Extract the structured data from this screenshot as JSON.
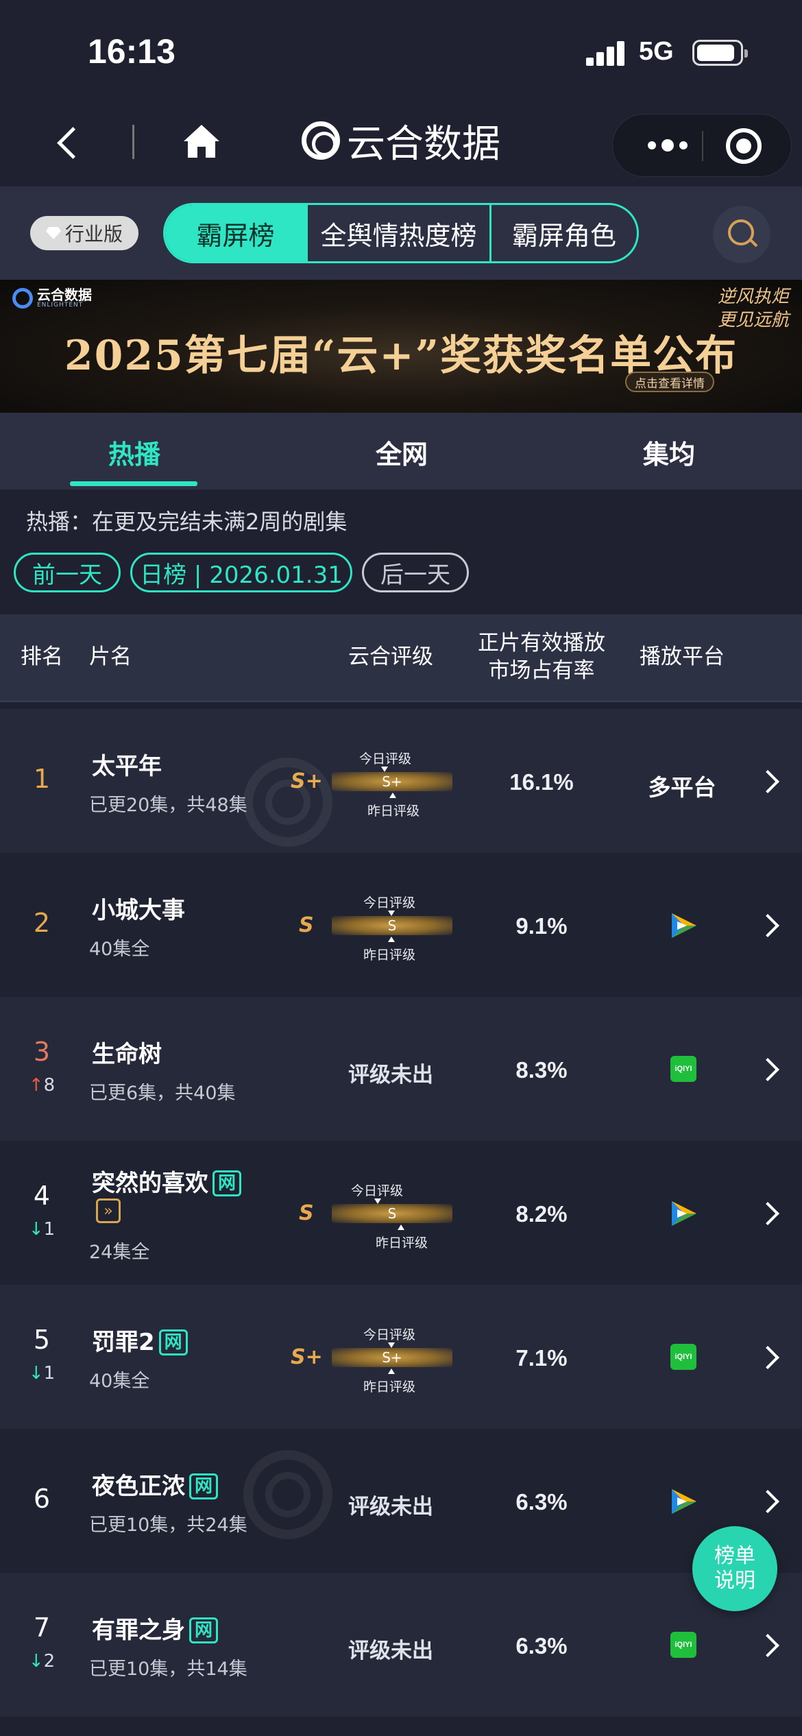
{
  "status_bar": {
    "time": "16:13",
    "network": "5G"
  },
  "nav": {
    "app_title": "云合数据"
  },
  "type_bar": {
    "badge": "行业版",
    "segments": [
      "霸屏榜",
      "全舆情热度榜",
      "霸屏角色"
    ],
    "active_segment": "霸屏榜"
  },
  "banner": {
    "logo_text": "云合数据",
    "logo_sub": "ENLIGHTENT",
    "title": "2025第七届“云+”奖获奖名单公布",
    "slogan_line1": "逆风执炬",
    "slogan_line2": "更见远航",
    "cta": "点击查看详情"
  },
  "list_tabs": {
    "items": [
      "热播",
      "全网",
      "集均"
    ],
    "active": "热播"
  },
  "description": "热播：在更及完结未满2周的剧集",
  "date_nav": {
    "prev": "前一天",
    "current": "日榜 | 2026.01.31",
    "next": "后一天"
  },
  "table_header": {
    "rank": "排名",
    "name": "片名",
    "grade": "云合评级",
    "share_line1": "正片有效播放",
    "share_line2": "市场占有率",
    "platform": "播放平台"
  },
  "grade_labels": {
    "today": "今日评级",
    "yesterday": "昨日评级"
  },
  "rows": [
    {
      "rank": "1",
      "title": "太平年",
      "net_badge": "",
      "subtitle": "已更20集，共48集",
      "grade": "S+",
      "grade_bar": "S+",
      "share": "16.1%",
      "platform": "多平台",
      "platform_icon": "",
      "trend": "",
      "trend_dir": ""
    },
    {
      "rank": "2",
      "title": "小城大事",
      "net_badge": "",
      "subtitle": "40集全",
      "grade": "S",
      "grade_bar": "S",
      "share": "9.1%",
      "platform": "",
      "platform_icon": "tencent-video-icon",
      "trend": "",
      "trend_dir": ""
    },
    {
      "rank": "3",
      "title": "生命树",
      "net_badge": "",
      "subtitle": "已更6集，共40集",
      "grade": "评级未出",
      "grade_bar": "",
      "share": "8.3%",
      "platform": "",
      "platform_icon": "iqiyi-icon",
      "trend": "8",
      "trend_dir": "up"
    },
    {
      "rank": "4",
      "title": "突然的喜欢",
      "net_badge": "网",
      "subtitle": "24集全",
      "grade": "S",
      "grade_bar": "S",
      "share": "8.2%",
      "platform": "",
      "platform_icon": "tencent-video-icon",
      "trend": "1",
      "trend_dir": "down"
    },
    {
      "rank": "5",
      "title": "罚罪2",
      "net_badge": "网",
      "subtitle": "40集全",
      "grade": "S+",
      "grade_bar": "S+",
      "share": "7.1%",
      "platform": "",
      "platform_icon": "iqiyi-icon",
      "trend": "1",
      "trend_dir": "down"
    },
    {
      "rank": "6",
      "title": "夜色正浓",
      "net_badge": "网",
      "subtitle": "已更10集，共24集",
      "grade": "评级未出",
      "grade_bar": "",
      "share": "6.3%",
      "platform": "",
      "platform_icon": "tencent-video-icon",
      "trend": "",
      "trend_dir": ""
    },
    {
      "rank": "7",
      "title": "有罪之身",
      "net_badge": "网",
      "subtitle": "已更10集，共14集",
      "grade": "评级未出",
      "grade_bar": "",
      "share": "6.3%",
      "platform": "",
      "platform_icon": "iqiyi-icon",
      "trend": "2",
      "trend_dir": "down"
    }
  ],
  "iqiyi_label": "iQIYI",
  "fab": {
    "line1": "榜单",
    "line2": "说明"
  },
  "colors": {
    "accent": "#2ee6c4",
    "rank_gold": "#e8a94c",
    "rank_three": "#e07a5f",
    "trend_up": "#f05a3c",
    "trend_down": "#2ee6c4",
    "background": "#1f2130"
  }
}
